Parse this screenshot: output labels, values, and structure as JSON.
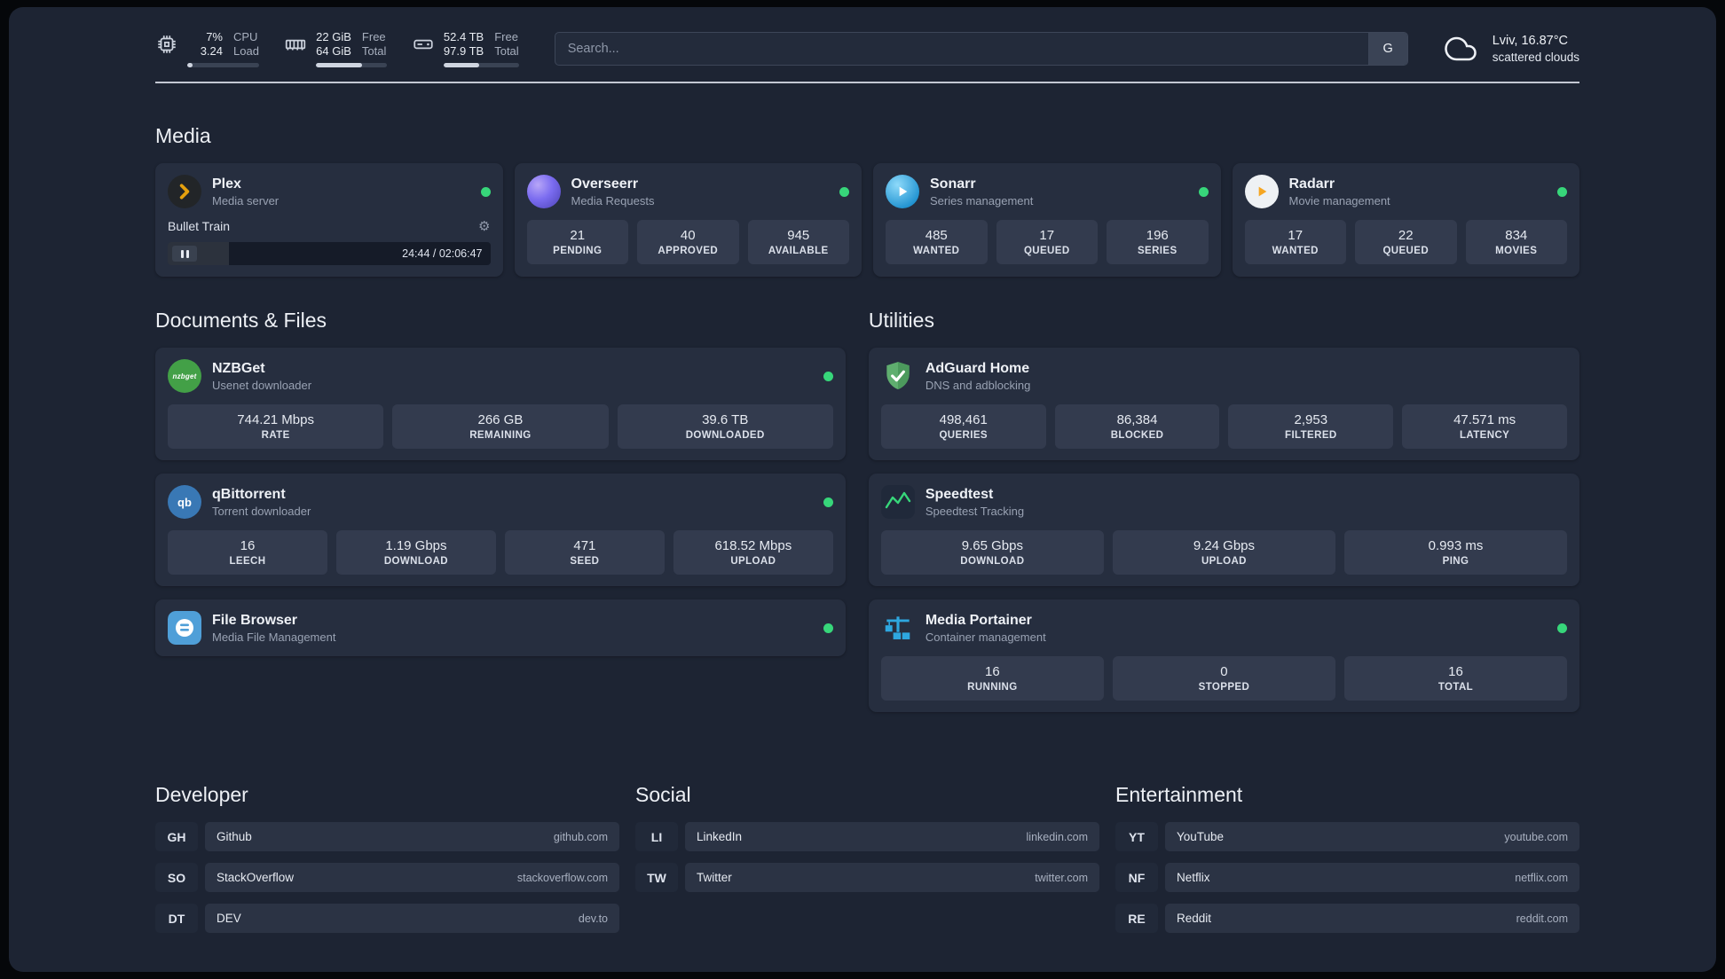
{
  "colors": {
    "background": "#1d2433",
    "card": "#262e3f",
    "stat_box": "#333b4e",
    "accent_green": "#37d67a",
    "plex_orange": "#e5a00d",
    "sonarr_blue": "#2193d1",
    "radarr_yellow": "#f5a623",
    "nzbget_green": "#43a047",
    "qbittorrent_blue": "#3978b5",
    "adguard_green": "#5fae6f",
    "portainer_blue": "#2ea7e0"
  },
  "topbar": {
    "cpu": {
      "value_top": "7%",
      "value_bottom": "3.24",
      "label_top": "CPU",
      "label_bottom": "Load",
      "bar_width": "7%"
    },
    "memory": {
      "value_top": "22 GiB",
      "value_bottom": "64 GiB",
      "label_top": "Free",
      "label_bottom": "Total",
      "bar_width": "65%"
    },
    "disk": {
      "value_top": "52.4 TB",
      "value_bottom": "97.9 TB",
      "label_top": "Free",
      "label_bottom": "Total",
      "bar_width": "47%"
    },
    "search": {
      "placeholder": "Search...",
      "button_label": "G"
    },
    "weather": {
      "location": "Lviv, 16.87°C",
      "condition": "scattered clouds"
    }
  },
  "media": {
    "title": "Media",
    "plex": {
      "name": "Plex",
      "subtitle": "Media server",
      "now_playing": "Bullet Train",
      "elapsed_total": "24:44 / 02:06:47",
      "progress_width": "19%"
    },
    "overseerr": {
      "name": "Overseerr",
      "subtitle": "Media Requests",
      "stats": [
        {
          "value": "21",
          "label": "PENDING"
        },
        {
          "value": "40",
          "label": "APPROVED"
        },
        {
          "value": "945",
          "label": "AVAILABLE"
        }
      ]
    },
    "sonarr": {
      "name": "Sonarr",
      "subtitle": "Series management",
      "stats": [
        {
          "value": "485",
          "label": "WANTED"
        },
        {
          "value": "17",
          "label": "QUEUED"
        },
        {
          "value": "196",
          "label": "SERIES"
        }
      ]
    },
    "radarr": {
      "name": "Radarr",
      "subtitle": "Movie management",
      "stats": [
        {
          "value": "17",
          "label": "WANTED"
        },
        {
          "value": "22",
          "label": "QUEUED"
        },
        {
          "value": "834",
          "label": "MOVIES"
        }
      ]
    }
  },
  "documents": {
    "title": "Documents & Files",
    "nzbget": {
      "name": "NZBGet",
      "subtitle": "Usenet downloader",
      "icon_text": "nzbget",
      "stats": [
        {
          "value": "744.21 Mbps",
          "label": "RATE"
        },
        {
          "value": "266 GB",
          "label": "REMAINING"
        },
        {
          "value": "39.6 TB",
          "label": "DOWNLOADED"
        }
      ]
    },
    "qbittorrent": {
      "name": "qBittorrent",
      "subtitle": "Torrent downloader",
      "icon_text": "qb",
      "stats": [
        {
          "value": "16",
          "label": "LEECH"
        },
        {
          "value": "1.19 Gbps",
          "label": "DOWNLOAD"
        },
        {
          "value": "471",
          "label": "SEED"
        },
        {
          "value": "618.52 Mbps",
          "label": "UPLOAD"
        }
      ]
    },
    "filebrowser": {
      "name": "File Browser",
      "subtitle": "Media File Management"
    }
  },
  "utilities": {
    "title": "Utilities",
    "adguard": {
      "name": "AdGuard Home",
      "subtitle": "DNS and adblocking",
      "stats": [
        {
          "value": "498,461",
          "label": "QUERIES"
        },
        {
          "value": "86,384",
          "label": "BLOCKED"
        },
        {
          "value": "2,953",
          "label": "FILTERED"
        },
        {
          "value": "47.571 ms",
          "label": "LATENCY"
        }
      ]
    },
    "speedtest": {
      "name": "Speedtest",
      "subtitle": "Speedtest Tracking",
      "stats": [
        {
          "value": "9.65 Gbps",
          "label": "DOWNLOAD"
        },
        {
          "value": "9.24 Gbps",
          "label": "UPLOAD"
        },
        {
          "value": "0.993 ms",
          "label": "PING"
        }
      ]
    },
    "portainer": {
      "name": "Media Portainer",
      "subtitle": "Container management",
      "stats": [
        {
          "value": "16",
          "label": "RUNNING"
        },
        {
          "value": "0",
          "label": "STOPPED"
        },
        {
          "value": "16",
          "label": "TOTAL"
        }
      ]
    }
  },
  "bookmarks": {
    "developer": {
      "title": "Developer",
      "items": [
        {
          "abbr": "GH",
          "name": "Github",
          "domain": "github.com"
        },
        {
          "abbr": "SO",
          "name": "StackOverflow",
          "domain": "stackoverflow.com"
        },
        {
          "abbr": "DT",
          "name": "DEV",
          "domain": "dev.to"
        }
      ]
    },
    "social": {
      "title": "Social",
      "items": [
        {
          "abbr": "LI",
          "name": "LinkedIn",
          "domain": "linkedin.com"
        },
        {
          "abbr": "TW",
          "name": "Twitter",
          "domain": "twitter.com"
        }
      ]
    },
    "entertainment": {
      "title": "Entertainment",
      "items": [
        {
          "abbr": "YT",
          "name": "YouTube",
          "domain": "youtube.com"
        },
        {
          "abbr": "NF",
          "name": "Netflix",
          "domain": "netflix.com"
        },
        {
          "abbr": "RE",
          "name": "Reddit",
          "domain": "reddit.com"
        }
      ]
    }
  }
}
